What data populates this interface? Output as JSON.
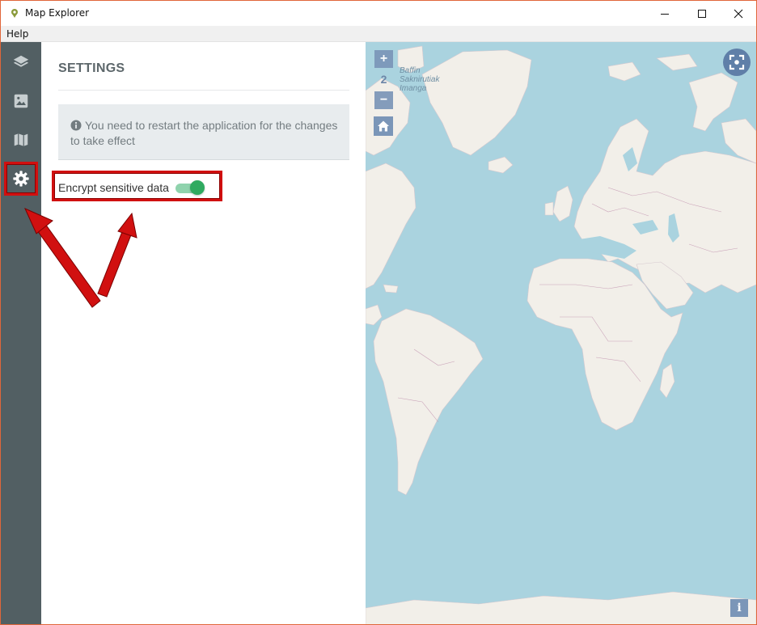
{
  "window": {
    "title": "Map Explorer"
  },
  "menu": {
    "items": [
      "Help"
    ]
  },
  "rail": {
    "items": [
      {
        "icon": "layers-icon"
      },
      {
        "icon": "image-icon"
      },
      {
        "icon": "map-icon"
      },
      {
        "icon": "gear-icon",
        "selected": true
      }
    ]
  },
  "settings": {
    "title": "SETTINGS",
    "notice": "You need to restart the application for the changes to take effect",
    "encrypt_label": "Encrypt sensitive data",
    "encrypt_enabled": true
  },
  "map": {
    "zoom_level": "2",
    "zoom_in_label": "+",
    "zoom_out_label": "−",
    "place_label_1": "Baffin",
    "place_label_2": "Saknirutiak",
    "place_label_3": "Imanga",
    "info_label": "i"
  },
  "colors": {
    "rail": "#525f63",
    "ocean": "#aad3df",
    "land": "#f2efe9",
    "toggle_on": "#2faa60",
    "annotation": "#d11010"
  }
}
